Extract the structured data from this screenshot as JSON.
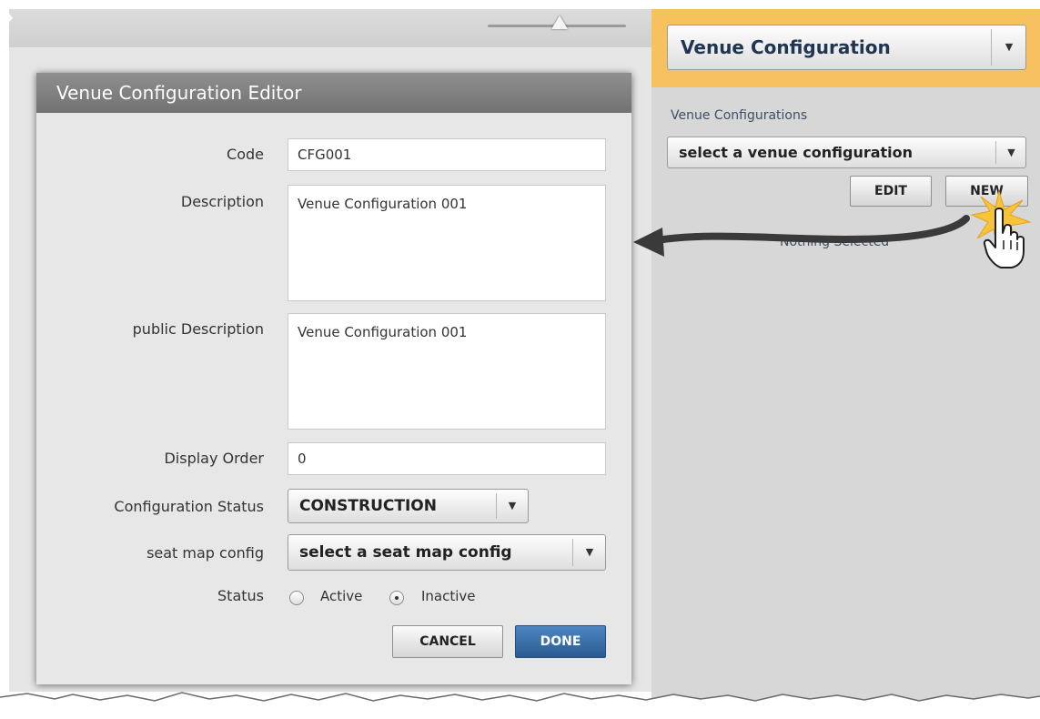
{
  "editor": {
    "title": "Venue Configuration Editor",
    "fields": {
      "code": {
        "label": "Code",
        "value": "CFG001"
      },
      "description": {
        "label": "Description",
        "value": "Venue Configuration 001"
      },
      "public_description": {
        "label": "public Description",
        "value": "Venue Configuration 001"
      },
      "display_order": {
        "label": "Display Order",
        "value": "0"
      },
      "configuration_status": {
        "label": "Configuration Status",
        "value": "CONSTRUCTION"
      },
      "seat_map_config": {
        "label": "seat map config",
        "value": "select a seat map config"
      },
      "status": {
        "label": "Status",
        "options": [
          "Active",
          "Inactive"
        ],
        "selected": "Inactive"
      }
    },
    "buttons": {
      "cancel": "CANCEL",
      "done": "DONE"
    }
  },
  "sidebar": {
    "module_select": "Venue Configuration",
    "list_label": "Venue Configurations",
    "list_select": "select a venue configuration",
    "buttons": {
      "edit": "EDIT",
      "new": "NEW"
    },
    "status_text": "Nothing Selected"
  },
  "colors": {
    "header_bg": "#f7c15f",
    "primary_button": "#2a5b90",
    "editor_header": "#7f7f7f"
  },
  "icons": [
    "dropdown-arrow-icon",
    "zoom-slider-thumb-icon",
    "hand-pointer-icon",
    "curved-arrow-icon",
    "click-burst-icon"
  ]
}
